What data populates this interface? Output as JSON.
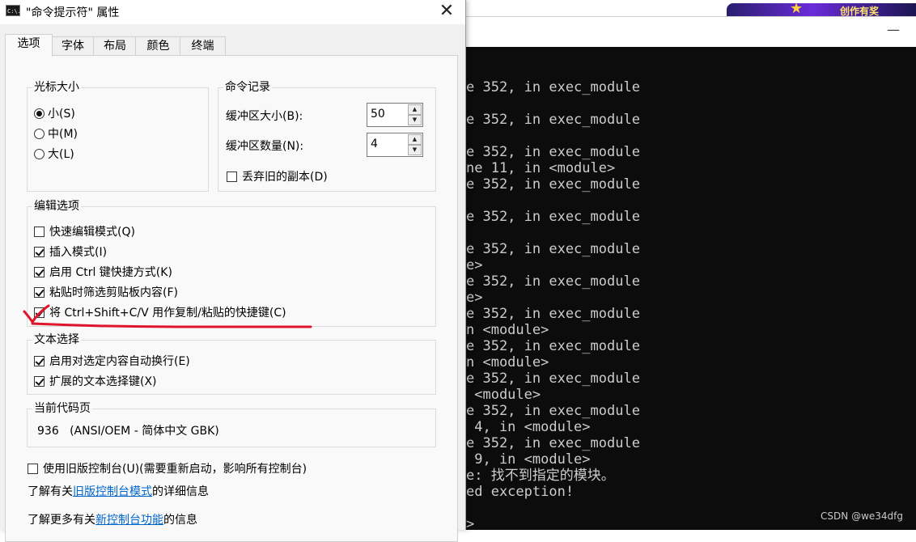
{
  "terminal": {
    "lines": [
      "e 352, in exec_module",
      "",
      "e 352, in exec_module",
      "",
      "e 352, in exec_module",
      "ne 11, in <module>",
      "e 352, in exec_module",
      "",
      "e 352, in exec_module",
      "",
      "e 352, in exec_module",
      "e>",
      "e 352, in exec_module",
      "e>",
      "e 352, in exec_module",
      "n <module>",
      "e 352, in exec_module",
      "n <module>",
      "e 352, in exec_module",
      " <module>",
      "e 352, in exec_module",
      " 4, in <module>",
      "e 352, in exec_module",
      " 9, in <module>",
      "e: 找不到指定的模块。",
      "ed exception!",
      "",
      ">"
    ],
    "minimize_glyph": "—",
    "watermark": "CSDN @we34dfg",
    "banner_text": "创作有奖"
  },
  "dialog": {
    "title": "\"命令提示符\" 属性",
    "icon_text": "C:\\.",
    "close_glyph": "✕",
    "tabs": [
      "选项",
      "字体",
      "布局",
      "颜色",
      "终端"
    ],
    "active_tab": 0,
    "cursor_size": {
      "label": "光标大小",
      "options": [
        "小(S)",
        "中(M)",
        "大(L)"
      ],
      "selected": 0
    },
    "command_history": {
      "label": "命令记录",
      "buffer_size_label": "缓冲区大小(B):",
      "buffer_size_value": "50",
      "buffer_count_label": "缓冲区数量(N):",
      "buffer_count_value": "4",
      "discard_label": "丢弃旧的副本(D)",
      "discard_checked": false
    },
    "edit_options": {
      "label": "编辑选项",
      "items": [
        {
          "label": "快速编辑模式(Q)",
          "checked": false
        },
        {
          "label": "插入模式(I)",
          "checked": true
        },
        {
          "label": "启用 Ctrl 键快捷方式(K)",
          "checked": true
        },
        {
          "label": "粘贴时筛选剪贴板内容(F)",
          "checked": true
        },
        {
          "label": "将 Ctrl+Shift+C/V 用作复制/粘贴的快捷键(C)",
          "checked": true
        }
      ]
    },
    "text_selection": {
      "label": "文本选择",
      "items": [
        {
          "label": "启用对选定内容自动换行(E)",
          "checked": true
        },
        {
          "label": "扩展的文本选择键(X)",
          "checked": true
        }
      ]
    },
    "codepage": {
      "label": "当前代码页",
      "value": "936   (ANSI/OEM - 简体中文 GBK)"
    },
    "legacy": {
      "label": "使用旧版控制台(U)(需要重新启动，影响所有控制台)",
      "checked": false
    },
    "info1": {
      "prefix": "了解有关",
      "link": "旧版控制台模式",
      "suffix": "的详细信息"
    },
    "info2": {
      "prefix": "了解更多有关",
      "link": "新控制台功能",
      "suffix": "的信息"
    }
  },
  "colors": {
    "annotation_red": "#e0142a",
    "link_blue": "#0066cc",
    "terminal_bg": "#0c0c0c",
    "terminal_fg": "#cccccc"
  }
}
